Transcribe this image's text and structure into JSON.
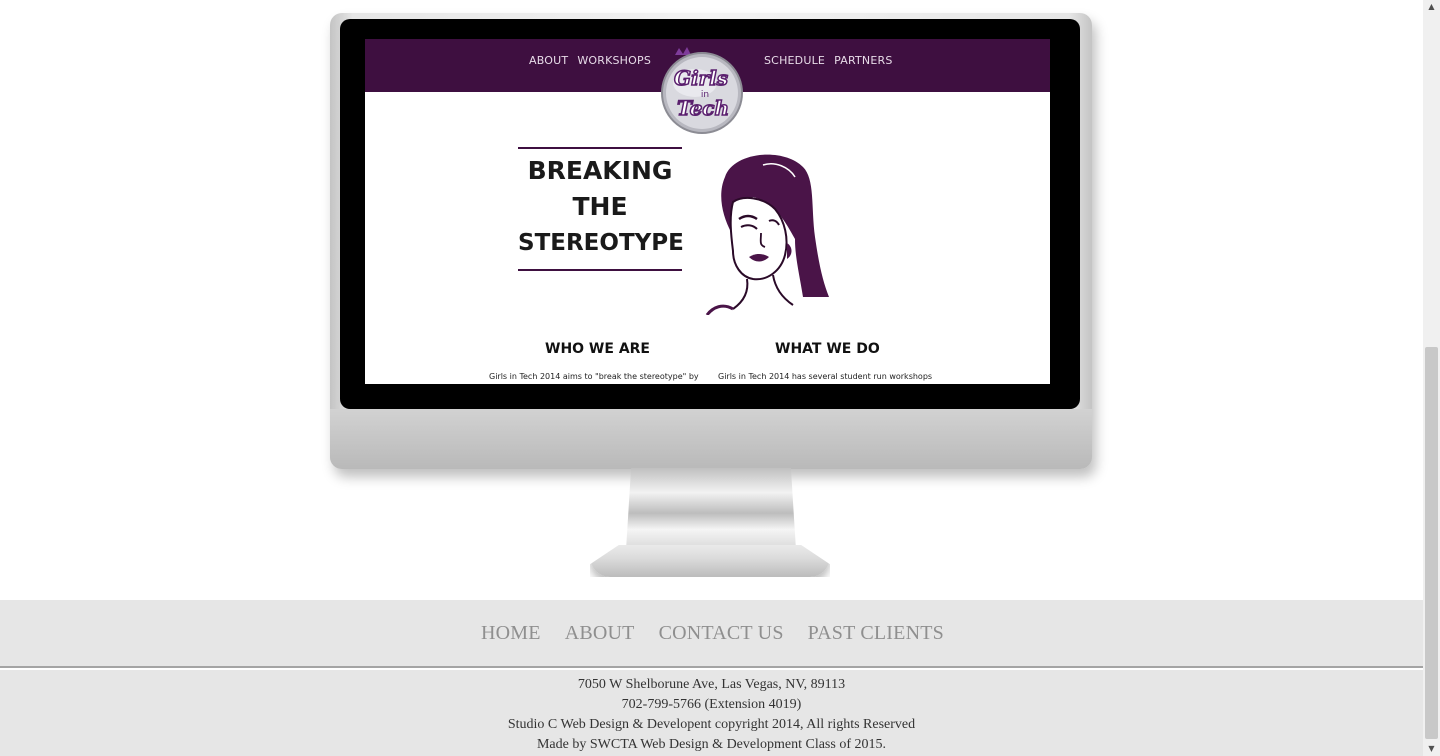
{
  "site": {
    "nav_left": [
      "ABOUT",
      "WORKSHOPS"
    ],
    "nav_right": [
      "SCHEDULE",
      "PARTNERS"
    ],
    "logo_text": [
      "Girls",
      "in",
      "Tech"
    ],
    "hero_lines": [
      "BREAKING",
      "THE",
      "STEREOTYPE"
    ],
    "who_title": "WHO WE ARE",
    "who_text": "Girls in Tech 2014 aims to \"break the stereotype\" by",
    "what_title": "WHAT WE DO",
    "what_text": "Girls in Tech 2014 has several student run workshops",
    "brand_color": "#3e0f40"
  },
  "footer": {
    "nav": [
      "HOME",
      "ABOUT",
      "CONTACT US",
      "PAST CLIENTS"
    ],
    "address": "7050 W Shelborune Ave, Las Vegas, NV, 89113",
    "phone": "702-799-5766 (Extension 4019)",
    "copyright": "Studio C Web Design & Developent copyright 2014, All rights Reserved",
    "credit": "Made by SWCTA Web Design & Development Class of 2015."
  },
  "scrollbar": {
    "up_icon": "scroll-up-arrow-icon",
    "down_icon": "scroll-down-arrow-icon"
  }
}
